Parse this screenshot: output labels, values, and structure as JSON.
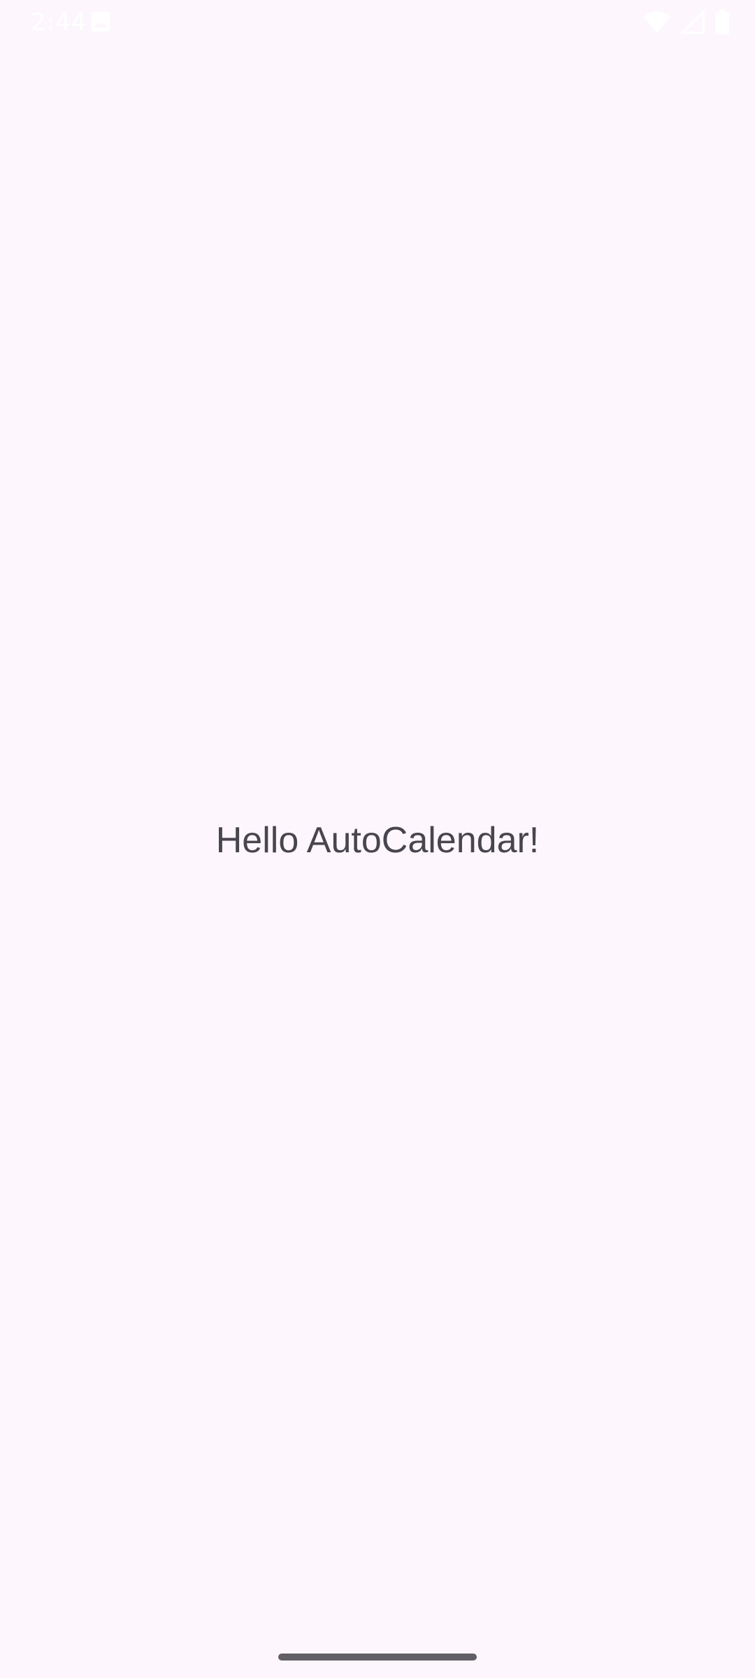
{
  "status_bar": {
    "time": "2:44",
    "icons": [
      "gallery-notification-icon",
      "wifi-icon",
      "cellular-signal-icon",
      "battery-icon"
    ],
    "icon_color": "#FFFFFF"
  },
  "main": {
    "greeting": "Hello AutoCalendar!",
    "text_color": "#49454F",
    "background_color": "#FDF7FD"
  },
  "navigation": {
    "gesture_handle_color": "#625F66"
  }
}
